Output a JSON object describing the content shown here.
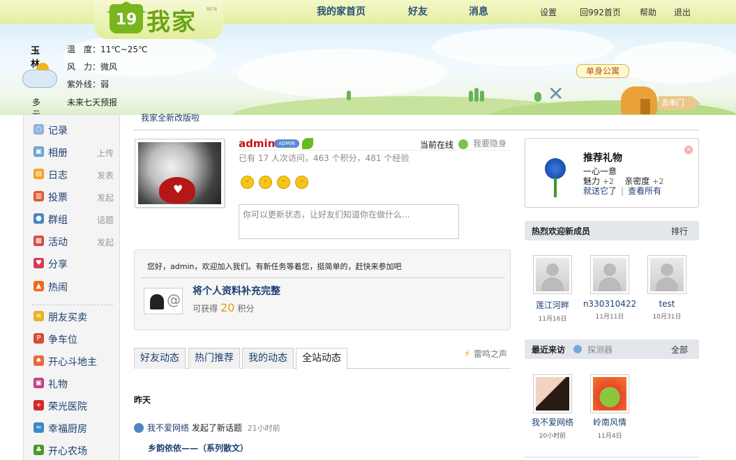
{
  "header": {
    "logo": {
      "badge": "19",
      "text": "我家",
      "beta": "BETA"
    },
    "main_nav": [
      "我的家首页",
      "好友",
      "消息"
    ],
    "sub_nav": [
      "设置",
      "回992首页",
      "帮助",
      "退出"
    ],
    "weather": {
      "city": "玉林",
      "temperature": "温　度：11℃~25℃",
      "wind": "风　力：微风",
      "uv": "紫外线：弱",
      "condition": "多云",
      "forecast_link": "未来七天预报"
    },
    "single_apartment": "单身公寓",
    "visit_sign": "去串门"
  },
  "sidebar": {
    "items": [
      {
        "label": "记录",
        "action": "",
        "icon": "record-icon"
      },
      {
        "label": "相册",
        "action": "上传",
        "icon": "album-icon"
      },
      {
        "label": "日志",
        "action": "发表",
        "icon": "blog-icon"
      },
      {
        "label": "投票",
        "action": "发起",
        "icon": "poll-icon"
      },
      {
        "label": "群组",
        "action": "话题",
        "icon": "group-icon"
      },
      {
        "label": "活动",
        "action": "发起",
        "icon": "event-icon"
      },
      {
        "label": "分享",
        "action": "",
        "icon": "share-icon"
      },
      {
        "label": "热闹",
        "action": "",
        "icon": "hot-icon"
      }
    ],
    "apps": [
      {
        "label": "朋友买卖",
        "icon": "coins-icon"
      },
      {
        "label": "争车位",
        "icon": "parking-icon"
      },
      {
        "label": "开心斗地主",
        "icon": "cards-icon"
      },
      {
        "label": "礼物",
        "icon": "gift-icon"
      },
      {
        "label": "荣光医院",
        "icon": "hospital-icon"
      },
      {
        "label": "幸福厨房",
        "icon": "kitchen-icon"
      },
      {
        "label": "开心农场",
        "icon": "farm-icon"
      }
    ]
  },
  "main": {
    "notice": "我家全新改版啦",
    "profile": {
      "username": "admin",
      "admin_badge": "ADMIN",
      "online_status": "当前在线",
      "stealth_label": "我要隐身",
      "stats": "已有 17 人次访问，463 个积分，481 个经验",
      "status_placeholder": "你可以更新状态，让好友们知道你在做什么..."
    },
    "task": {
      "welcome": "您好，admin，欢迎加入我们。有新任务等着您，挺简单的，赶快来参加吧",
      "title": "将个人资料补充完整",
      "reward_prefix": "可获得",
      "reward_value": "20",
      "reward_unit": "积分"
    },
    "tabs": [
      "好友动态",
      "热门推荐",
      "我的动态",
      "全站动态"
    ],
    "active_tab": "全站动态",
    "thunder_label": "雷鸣之声",
    "feed": {
      "day": "昨天",
      "user": "我不爱网络",
      "action": "发起了新话题",
      "time": "21小时前",
      "topic": "乡韵依依——（系列散文）"
    }
  },
  "right": {
    "gift": {
      "title": "推荐礼物",
      "name": "一心一意",
      "charm_label": "魅力",
      "charm_value": "+2",
      "intimacy_label": "亲密度",
      "intimacy_value": "+2",
      "send_link": "就送它了",
      "view_all_link": "查看所有",
      "close": "×"
    },
    "new_members": {
      "title": "热烈欢迎新成员",
      "ranking_link": "排行",
      "members": [
        {
          "name": "莲江河畔",
          "date": "11月16日"
        },
        {
          "name": "n330310422",
          "date": "11月11日"
        },
        {
          "name": "test",
          "date": "10月31日"
        }
      ]
    },
    "recent_visitors": {
      "title": "最近来访",
      "probe": "探测器",
      "all_link": "全部",
      "visitors": [
        {
          "name": "我不爱网络",
          "time": "20小时前"
        },
        {
          "name": "岭南风情",
          "time": "11月4日"
        }
      ]
    }
  },
  "colors": {
    "nav_blue": "#1d3f72",
    "username_red": "#c8121a",
    "logo_green": "#6aa514",
    "reward_orange": "#e59b0d"
  }
}
